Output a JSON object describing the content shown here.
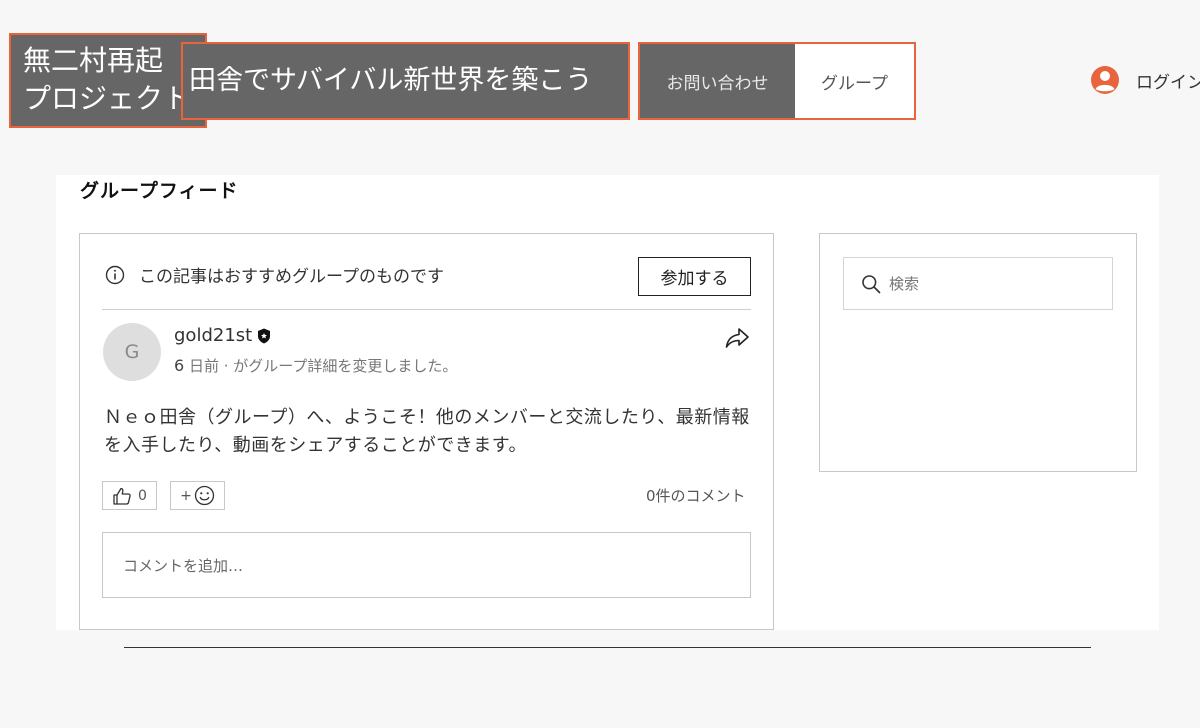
{
  "header": {
    "logo_line1": "無二村再起",
    "logo_line2": "プロジェクト",
    "tagline": "田舎でサバイバル新世界を築こう",
    "nav": {
      "contact": "お問い合わせ",
      "group": "グループ"
    },
    "login_label": "ログイン"
  },
  "feed": {
    "title": "グループフィード",
    "post": {
      "recommendation": "この記事はおすすめグループのものです",
      "join_label": "参加する",
      "avatar_initial": "G",
      "author": "gold21st",
      "meta_days": "6",
      "meta_rest": " 日前 · がグループ詳細を変更しました。",
      "body": "Ｎｅｏ田舎（グループ）へ、ようこそ！他のメンバーと交流したり、最新情報を入手したり、動画をシェアすることができます。",
      "like_count": "0",
      "react_plus": "+",
      "comments_label": "0件のコメント",
      "comment_placeholder": "コメントを追加…"
    }
  },
  "sidebar": {
    "search_placeholder": "検索"
  },
  "colors": {
    "accent": "#e8643c",
    "header_gray": "#666666",
    "page_bg": "#f7f7f7"
  },
  "icons": {
    "login": "user-avatar-icon",
    "info": "info-icon",
    "badge": "shield-badge-icon",
    "share": "share-icon",
    "like": "thumbs-up-icon",
    "react": "smiley-icon",
    "search": "search-icon"
  }
}
